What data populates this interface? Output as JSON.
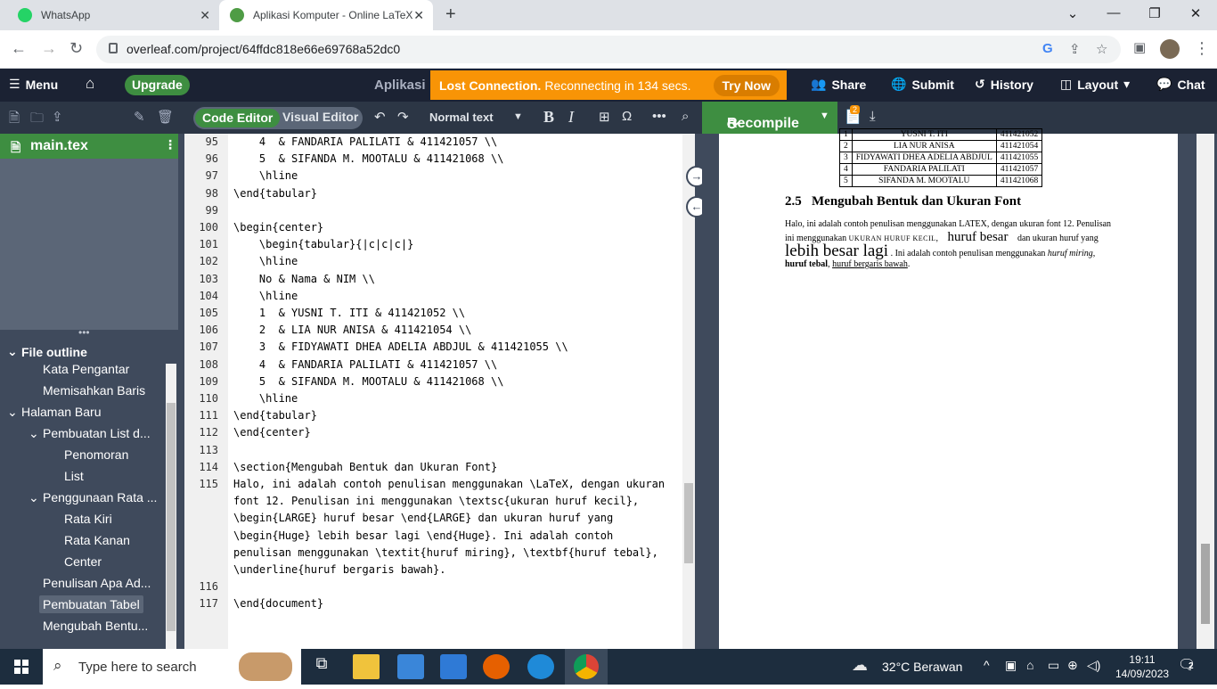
{
  "browser": {
    "tabs": [
      {
        "title": "WhatsApp",
        "icon": "whatsapp-icon"
      },
      {
        "title": "Aplikasi Komputer - Online LaTeX",
        "icon": "overleaf-icon"
      }
    ],
    "url": "overleaf.com/project/64ffdc818e66e69768a52dc0"
  },
  "overleaf_header": {
    "menu": "Menu",
    "upgrade": "Upgrade",
    "project_title": "Aplikasi",
    "lost_connection_bold": "Lost Connection.",
    "lost_connection_text": "Reconnecting in 134 secs.",
    "try_now": "Try Now",
    "share": "Share",
    "submit": "Submit",
    "history": "History",
    "layout": "Layout",
    "chat": "Chat"
  },
  "editor_toolbar": {
    "code_editor": "Code Editor",
    "visual_editor": "Visual Editor",
    "text_style": "Normal text",
    "recompile": "Recompile",
    "log_badge": "2"
  },
  "file_tree": {
    "main_file": "main.tex"
  },
  "outline": {
    "header": "File outline",
    "items": [
      "Kata Pengantar",
      "Memisahkan Baris",
      "Halaman Baru",
      "Pembuatan List d...",
      "Penomoran",
      "List",
      "Penggunaan Rata ...",
      "Rata Kiri",
      "Rata Kanan",
      "Center",
      "Penulisan Apa Ad...",
      "Pembuatan Tabel",
      "Mengubah Bentu..."
    ]
  },
  "code_lines": [
    {
      "n": "95",
      "t": "    4  & FANDARIA PALILATI & 411421057 \\\\"
    },
    {
      "n": "96",
      "t": "    5  & SIFANDA M. MOOTALU & 411421068 \\\\"
    },
    {
      "n": "97",
      "t": "    \\hline"
    },
    {
      "n": "98",
      "t": "\\end{tabular}"
    },
    {
      "n": "99",
      "t": ""
    },
    {
      "n": "100",
      "t": "\\begin{center}"
    },
    {
      "n": "101",
      "t": "    \\begin{tabular}{|c|c|c|}"
    },
    {
      "n": "102",
      "t": "    \\hline"
    },
    {
      "n": "103",
      "t": "    No & Nama & NIM \\\\"
    },
    {
      "n": "104",
      "t": "    \\hline"
    },
    {
      "n": "105",
      "t": "    1  & YUSNI T. ITI & 411421052 \\\\"
    },
    {
      "n": "106",
      "t": "    2  & LIA NUR ANISA & 411421054 \\\\"
    },
    {
      "n": "107",
      "t": "    3  & FIDYAWATI DHEA ADELIA ABDJUL & 411421055 \\\\"
    },
    {
      "n": "108",
      "t": "    4  & FANDARIA PALILATI & 411421057 \\\\"
    },
    {
      "n": "109",
      "t": "    5  & SIFANDA M. MOOTALU & 411421068 \\\\"
    },
    {
      "n": "110",
      "t": "    \\hline"
    },
    {
      "n": "111",
      "t": "\\end{tabular}"
    },
    {
      "n": "112",
      "t": "\\end{center}"
    },
    {
      "n": "113",
      "t": ""
    },
    {
      "n": "114",
      "t": "\\section{Mengubah Bentuk dan Ukuran Font}"
    },
    {
      "n": "115",
      "t": "Halo, ini adalah contoh penulisan menggunakan \\LaTeX, dengan ukuran"
    },
    {
      "n": "",
      "t": "font 12. Penulisan ini menggunakan \\textsc{ukuran huruf kecil},"
    },
    {
      "n": "",
      "t": "\\begin{LARGE} huruf besar \\end{LARGE} dan ukuran huruf yang"
    },
    {
      "n": "",
      "t": "\\begin{Huge} lebih besar lagi \\end{Huge}. Ini adalah contoh"
    },
    {
      "n": "",
      "t": "penulisan menggunakan \\textit{huruf miring}, \\textbf{huruf tebal},"
    },
    {
      "n": "",
      "t": "\\underline{huruf bergaris bawah}."
    },
    {
      "n": "116",
      "t": ""
    },
    {
      "n": "117",
      "t": "\\end{document}"
    }
  ],
  "pdf": {
    "table_rows": [
      [
        "1",
        "YUSNI T. ITI",
        "411421052"
      ],
      [
        "2",
        "LIA NUR ANISA",
        "411421054"
      ],
      [
        "3",
        "FIDYAWATI DHEA ADELIA ABDJUL",
        "411421055"
      ],
      [
        "4",
        "FANDARIA PALILATI",
        "411421057"
      ],
      [
        "5",
        "SIFANDA M. MOOTALU",
        "411421068"
      ]
    ],
    "section_number": "2.5",
    "section_title": "Mengubah Bentuk dan Ukuran Font",
    "para_line1": "Halo, ini adalah contoh penulisan menggunakan LATEX, dengan ukuran font 12. Penulisan",
    "para_line2a": "ini menggunakan",
    "para_line2_sc": "UKURAN HURUF KECIL",
    "para_line2_large": "huruf besar",
    "para_line2b": "dan ukuran huruf yang",
    "para_line3_huge": "lebih besar lagi",
    "para_line3a": ". Ini adalah contoh penulisan menggunakan",
    "para_line3_it": "huruf miring",
    "para_line4_bf": "huruf tebal",
    "para_line4_ul": "huruf bergaris bawah"
  },
  "taskbar": {
    "search_placeholder": "Type here to search",
    "weather": "32°C  Berawan",
    "time": "19:11",
    "date": "14/09/2023",
    "notifications": "2"
  }
}
